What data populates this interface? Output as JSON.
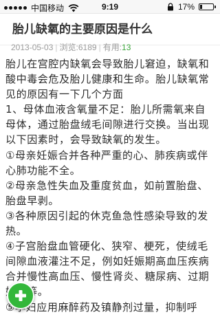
{
  "status_bar": {
    "carrier": "中国移动",
    "time": "9:19",
    "battery_percent_text": "17%",
    "battery_level": 0.17
  },
  "article": {
    "title": "胎儿缺氧的主要原因是什么",
    "meta": {
      "date": "2013-05-03",
      "views_label": "浏览:",
      "views_value": "6189",
      "useful_label": "有用:",
      "useful_value": "13"
    },
    "paragraphs": [
      "胎儿在宫腔内缺氧会导致胎儿窘迫，缺氧和酸中毒会危及胎儿健康和生命。胎儿缺氧常见的原因有一下几个方面",
      "1、母体血液含氧量不足：胎儿所需氧来自母体，通过胎盘绒毛间隙进行交换。当出现以下因素时，会导致缺氧的发生。",
      "①母亲妊娠合并各种严重的心、肺疾病或伴心肺功能不全。",
      "②母亲急性失血及重度贫血，如前置胎盘、胎盘早剥。",
      "③各种原因引起的休克鱼急性感染导致的发热。",
      "④子宫胎盘血管硬化、狭窄、梗死，使绒毛间隙血液灌注不足，例如妊娠期高血压疾病合并慢性高血压、慢性肾炎、糖尿病、过期妊娠等。",
      "⑤孕妇应用麻醉药及镇静剂过量，抑制呼"
    ]
  },
  "icons": {
    "fab": "plus-icon",
    "fab_color": "#33b73a"
  }
}
